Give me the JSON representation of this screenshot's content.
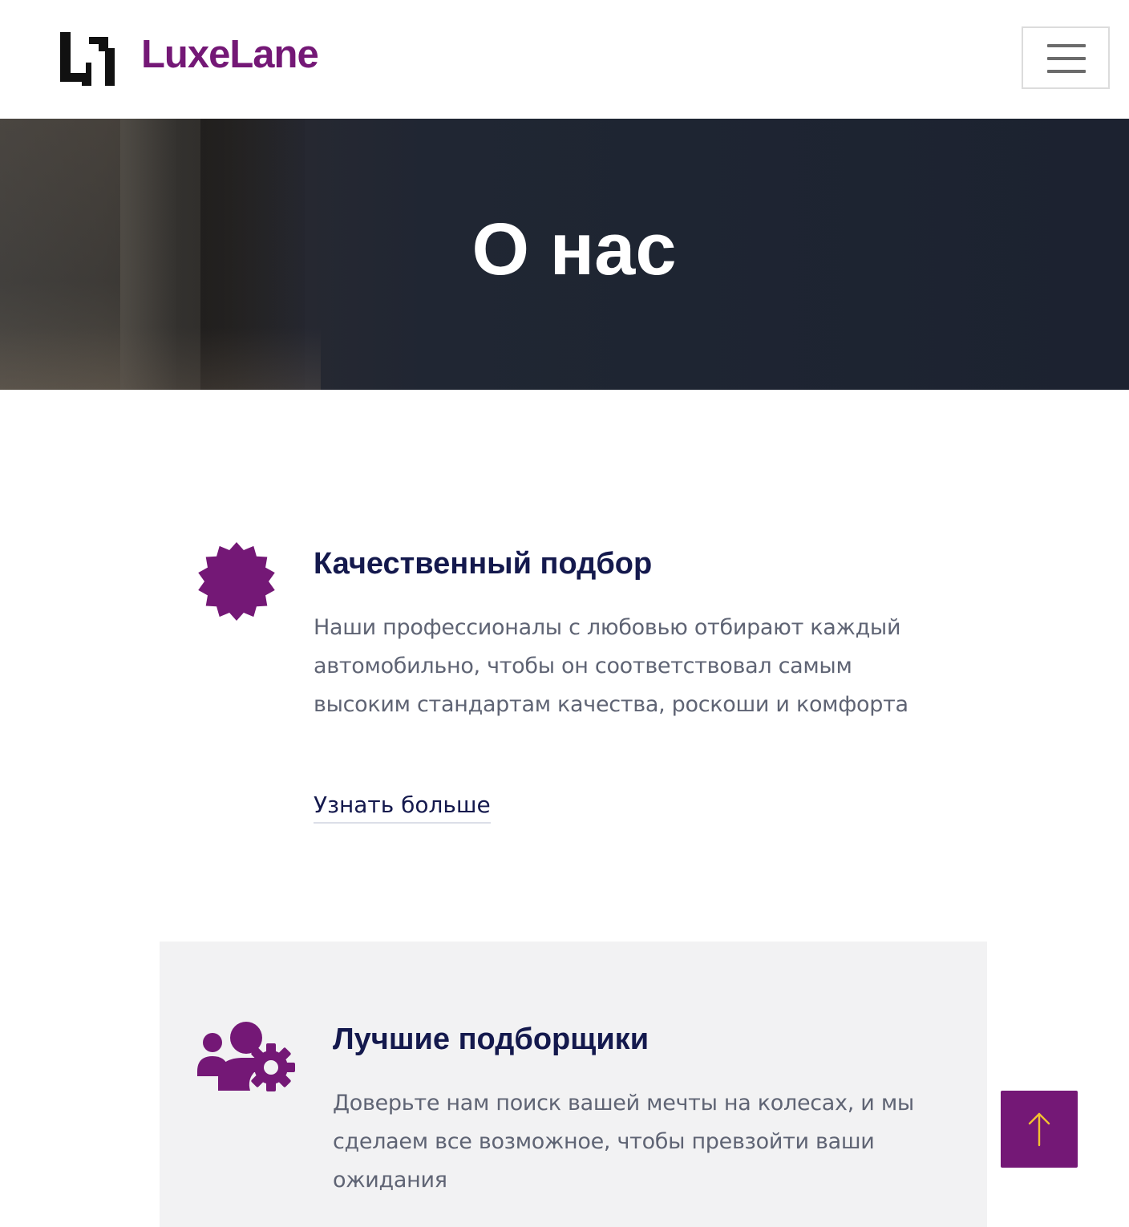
{
  "header": {
    "brand_name": "LuxeLane",
    "menu_icon": "hamburger-menu-icon"
  },
  "hero": {
    "title": "О нас"
  },
  "features": [
    {
      "icon": "badge-star-icon",
      "title": "Качественный подбор",
      "text": "Наши профессионалы с любовью отбирают каждый автомобильно, чтобы он соответствовал самым высоким стандартам качества, роскоши и комфорта",
      "link_label": "Узнать больше"
    },
    {
      "icon": "users-gear-icon",
      "title": "Лучшие подборщики",
      "text": "Доверьте нам поиск вашей мечты на колесах, и мы сделаем все возможное, чтобы превзойти ваши ожидания"
    }
  ],
  "scroll_top": {
    "icon": "arrow-up-icon"
  },
  "colors": {
    "brand": "#741876",
    "heading": "#14194d",
    "body_text": "#5f6474",
    "scroll_arrow": "#f2c230",
    "card_background": "#f2f2f3"
  }
}
